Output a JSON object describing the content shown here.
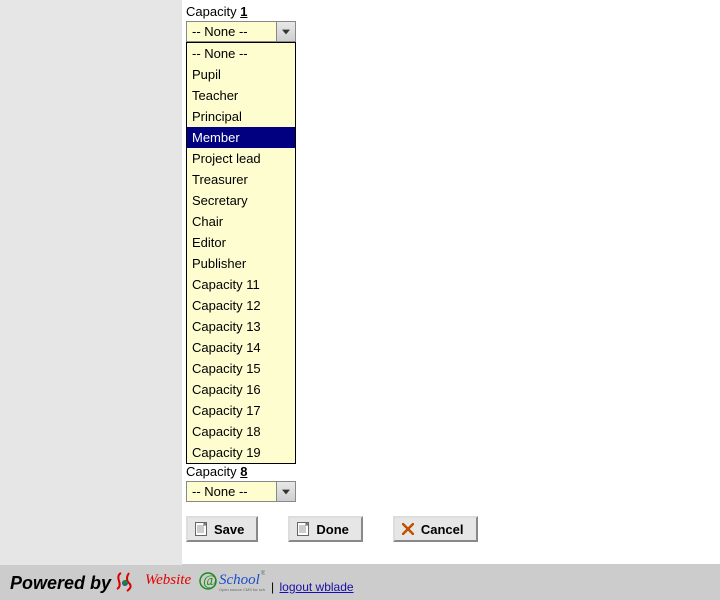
{
  "capacity1": {
    "label_prefix": "Capacity ",
    "label_num": "1",
    "selected_display": "-- None --",
    "options": [
      "-- None --",
      "Pupil",
      "Teacher",
      "Principal",
      "Member",
      "Project lead",
      "Treasurer",
      "Secretary",
      "Chair",
      "Editor",
      "Publisher",
      "Capacity 11",
      "Capacity 12",
      "Capacity 13",
      "Capacity 14",
      "Capacity 15",
      "Capacity 16",
      "Capacity 17",
      "Capacity 18",
      "Capacity 19"
    ],
    "highlighted_index": 4
  },
  "capacity8": {
    "label_prefix": "Capacity ",
    "label_num": "8",
    "selected_display": "-- None --"
  },
  "buttons": {
    "save": "Save",
    "done": "Done",
    "cancel": "Cancel"
  },
  "footer": {
    "powered_by": "Powered by",
    "logo_text_1": "Website",
    "logo_at": "@",
    "logo_text_2": "School",
    "logout_text": "logout wblade"
  }
}
